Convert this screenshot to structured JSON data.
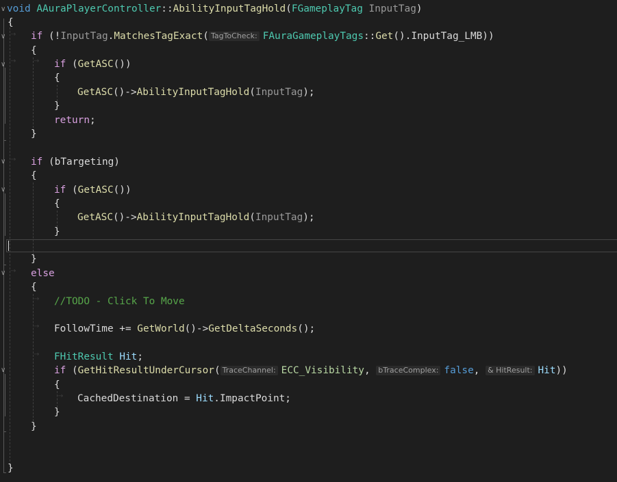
{
  "editor": {
    "fold_marker": "∨",
    "lines": {
      "l01": {
        "kw_void": "void",
        "class": "AAuraPlayerController",
        "scope": "::",
        "func": "AbilityInputTagHold",
        "open": "(",
        "param_type": "FGameplayTag",
        "param": "InputTag",
        "close": ")"
      },
      "l02": {
        "brace": "{"
      },
      "l03": {
        "kw_if": "if",
        "open": " (!",
        "var": "InputTag",
        "dot": ".",
        "method": "MatchesTagExact",
        "paren": "(",
        "hint": "TagToCheck:",
        "type": "FAuraGameplayTags",
        "scope": "::",
        "get": "Get",
        "call": "().",
        "member": "InputTag_LMB",
        "close": "))"
      },
      "l04": {
        "brace": "{"
      },
      "l05": {
        "kw_if": "if",
        "open": " (",
        "func": "GetASC",
        "close": "())"
      },
      "l06": {
        "brace": "{"
      },
      "l07": {
        "func": "GetASC",
        "arrow": "()->",
        "method": "AbilityInputTagHold",
        "open": "(",
        "arg": "InputTag",
        "close": ");"
      },
      "l08": {
        "brace": "}"
      },
      "l09": {
        "kw_return": "return",
        "semi": ";"
      },
      "l10": {
        "brace": "}"
      },
      "l12": {
        "kw_if": "if",
        "open": " (",
        "var": "bTargeting",
        "close": ")"
      },
      "l13": {
        "brace": "{"
      },
      "l14": {
        "kw_if": "if",
        "open": " (",
        "func": "GetASC",
        "close": "())"
      },
      "l15": {
        "brace": "{"
      },
      "l16": {
        "func": "GetASC",
        "arrow": "()->",
        "method": "AbilityInputTagHold",
        "open": "(",
        "arg": "InputTag",
        "close": ");"
      },
      "l17": {
        "brace": "}"
      },
      "l19": {
        "brace": "}"
      },
      "l20": {
        "kw_else": "else"
      },
      "l21": {
        "brace": "{"
      },
      "l22": {
        "comment": "//TODO - Click To Move"
      },
      "l24": {
        "var": "FollowTime",
        "op": " += ",
        "func": "GetWorld",
        "arrow": "()->",
        "method": "GetDeltaSeconds",
        "close": "();"
      },
      "l26": {
        "type": "FHitResult",
        "space": " ",
        "var": "Hit",
        "semi": ";"
      },
      "l27": {
        "kw_if": "if",
        "open": " (",
        "func": "GetHitResultUnderCursor",
        "paren": "(",
        "hint1": "TraceChannel:",
        "enum": "ECC_Visibility",
        "comma1": ", ",
        "hint2": "bTraceComplex:",
        "kw_false": "false",
        "comma2": ", ",
        "hint3": "& HitResult:",
        "arg": "Hit",
        "close": "))"
      },
      "l28": {
        "brace": "{"
      },
      "l29": {
        "var": "CachedDestination",
        "op": " = ",
        "obj": "Hit",
        "dot": ".",
        "member": "ImpactPoint",
        "semi": ";"
      },
      "l30": {
        "brace": "}"
      },
      "l31": {
        "brace": "}"
      },
      "l34": {
        "brace": "}"
      }
    }
  }
}
